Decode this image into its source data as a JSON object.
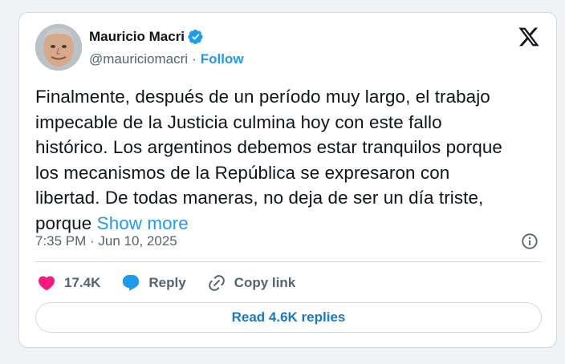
{
  "author": {
    "name": "Mauricio Macri",
    "handle": "@mauriciomacri",
    "separator": "·",
    "follow_label": "Follow",
    "verified": true
  },
  "tweet": {
    "lines": [
      "Finalmente, después de un período muy largo, el trabajo",
      "impecable de la Justicia culmina hoy con este fallo",
      "histórico. Los argentinos debemos estar tranquilos porque",
      "los mecanismos de la República se expresaron con",
      "libertad. De todas maneras, no deja de ser un día triste,",
      "porque"
    ],
    "show_more_label": "Show more",
    "timestamp": "7:35 PM · Jun 10, 2025"
  },
  "actions": {
    "likes_count": "17.4K",
    "reply_label": "Reply",
    "copy_link_label": "Copy link"
  },
  "replies_button_label": "Read 4.6K replies",
  "icons": {
    "verified": "verified-badge-icon",
    "logo": "x-logo-icon",
    "info": "info-icon",
    "like": "heart-icon",
    "reply": "reply-bubble-icon",
    "link": "link-icon"
  },
  "colors": {
    "accent": "#1d9bf0",
    "heart": "#f91880",
    "text": "#0f1419",
    "muted": "#536471",
    "border": "#cfd9de"
  }
}
